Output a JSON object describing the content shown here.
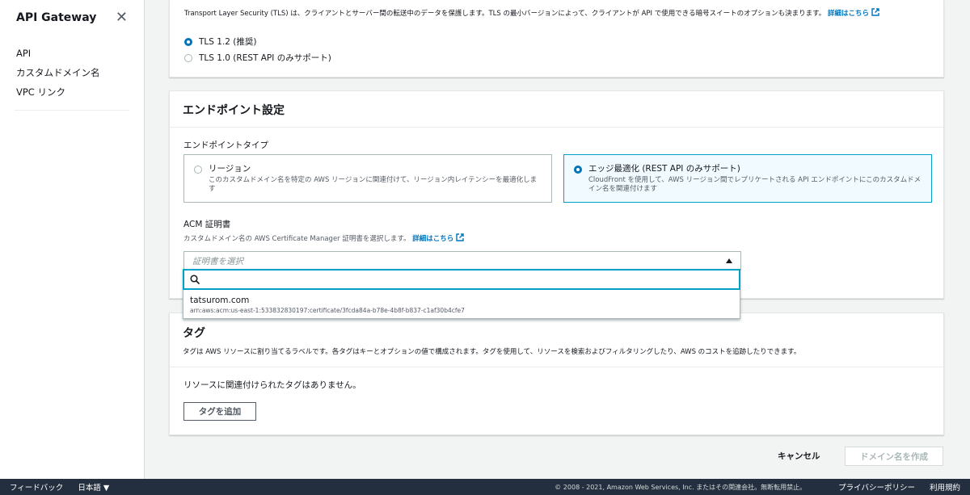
{
  "sidebar": {
    "title": "API Gateway",
    "items": [
      {
        "label": "API"
      },
      {
        "label": "カスタムドメイン名"
      },
      {
        "label": "VPC リンク"
      }
    ]
  },
  "tls": {
    "description": "Transport Layer Security (TLS) は、クライアントとサーバー間の転送中のデータを保護します。TLS の最小バージョンによって、クライアントが API で使用できる暗号スイートのオプションも決まります。",
    "learn_more": "詳細はこちら",
    "options": [
      {
        "label": "TLS 1.2 (推奨)",
        "selected": true
      },
      {
        "label": "TLS 1.0 (REST API のみサポート)",
        "selected": false
      }
    ]
  },
  "endpoint": {
    "title": "エンドポイント設定",
    "type_label": "エンドポイントタイプ",
    "types": [
      {
        "title": "リージョン",
        "desc": "このカスタムドメイン名を特定の AWS リージョンに関連付けて、リージョン内レイテンシーを最適化します",
        "selected": false
      },
      {
        "title": "エッジ最適化 (REST API のみサポート)",
        "desc": "CloudFront を使用して、AWS リージョン間でレプリケートされる API エンドポイントにこのカスタムドメイン名を関連付けます",
        "selected": true
      }
    ],
    "acm_label": "ACM 証明書",
    "acm_hint": "カスタムドメイン名の AWS Certificate Manager 証明書を選択します。",
    "acm_learn_more": "詳細はこちら",
    "select_placeholder": "証明書を選択",
    "dropdown": {
      "search_value": "",
      "options": [
        {
          "label": "tatsurom.com",
          "sub": "arn:aws:acm:us-east-1:533832830197:certificate/3fcda84a-b78e-4b8f-b837-c1af30b4cfe7"
        }
      ]
    }
  },
  "tags": {
    "title": "タグ",
    "desc": "タグは AWS リソースに割り当てるラベルです。各タグはキーとオプションの値で構成されます。タグを使用して、リソースを検索およびフィルタリングしたり、AWS のコストを追跡したりできます。",
    "empty": "リソースに関連付けられたタグはありません。",
    "add_button": "タグを追加"
  },
  "actions": {
    "cancel": "キャンセル",
    "create": "ドメイン名を作成"
  },
  "footer": {
    "feedback": "フィードバック",
    "language": "日本語 ▼",
    "copyright": "© 2008 - 2021, Amazon Web Services, Inc. またはその関連会社。無断転用禁止。",
    "privacy": "プライバシーポリシー",
    "terms": "利用規約"
  },
  "colors": {
    "accent": "#0073bb",
    "focus": "#00a1c9",
    "footer_bg": "#232f3e"
  }
}
